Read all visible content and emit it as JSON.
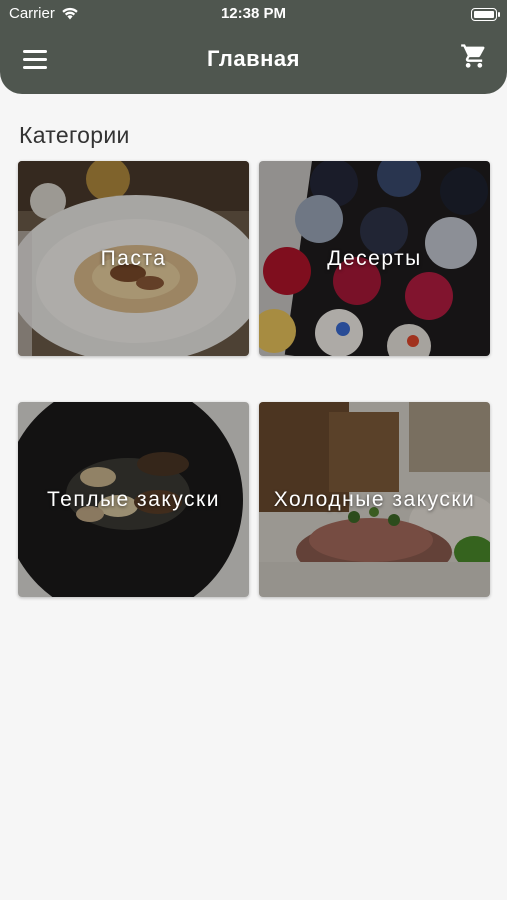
{
  "status_bar": {
    "carrier": "Carrier",
    "time": "12:38 PM"
  },
  "header": {
    "title": "Главная",
    "menu_icon": "hamburger-menu-icon",
    "cart_icon": "shopping-cart-icon"
  },
  "colors": {
    "header_bg": "#4f564f",
    "page_bg": "#f6f6f6"
  },
  "section_title": "Категории",
  "categories": [
    {
      "label": "Паста"
    },
    {
      "label": "Десерты"
    },
    {
      "label": "Теплые закуски"
    },
    {
      "label": "Холодные закуски"
    }
  ]
}
